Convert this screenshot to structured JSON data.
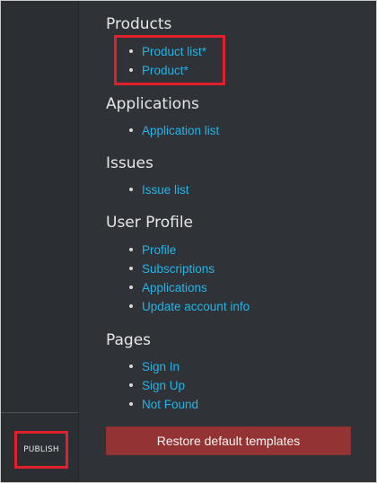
{
  "sidebar": {
    "publish_label": "PUBLISH"
  },
  "sections": [
    {
      "title": "Products",
      "items": [
        "Product list*",
        "Product*"
      ]
    },
    {
      "title": "Applications",
      "items": [
        "Application list"
      ]
    },
    {
      "title": "Issues",
      "items": [
        "Issue list"
      ]
    },
    {
      "title": "User Profile",
      "items": [
        "Profile",
        "Subscriptions",
        "Applications",
        "Update account info"
      ]
    },
    {
      "title": "Pages",
      "items": [
        "Sign In",
        "Sign Up",
        "Not Found"
      ]
    }
  ],
  "restore_button_label": "Restore default templates",
  "colors": {
    "background": "#2f3338",
    "left_rail": "#2b2f33",
    "link": "#22b4e8",
    "heading": "#e6e6e6",
    "highlight": "#e0202b",
    "restore_button": "#943333"
  }
}
